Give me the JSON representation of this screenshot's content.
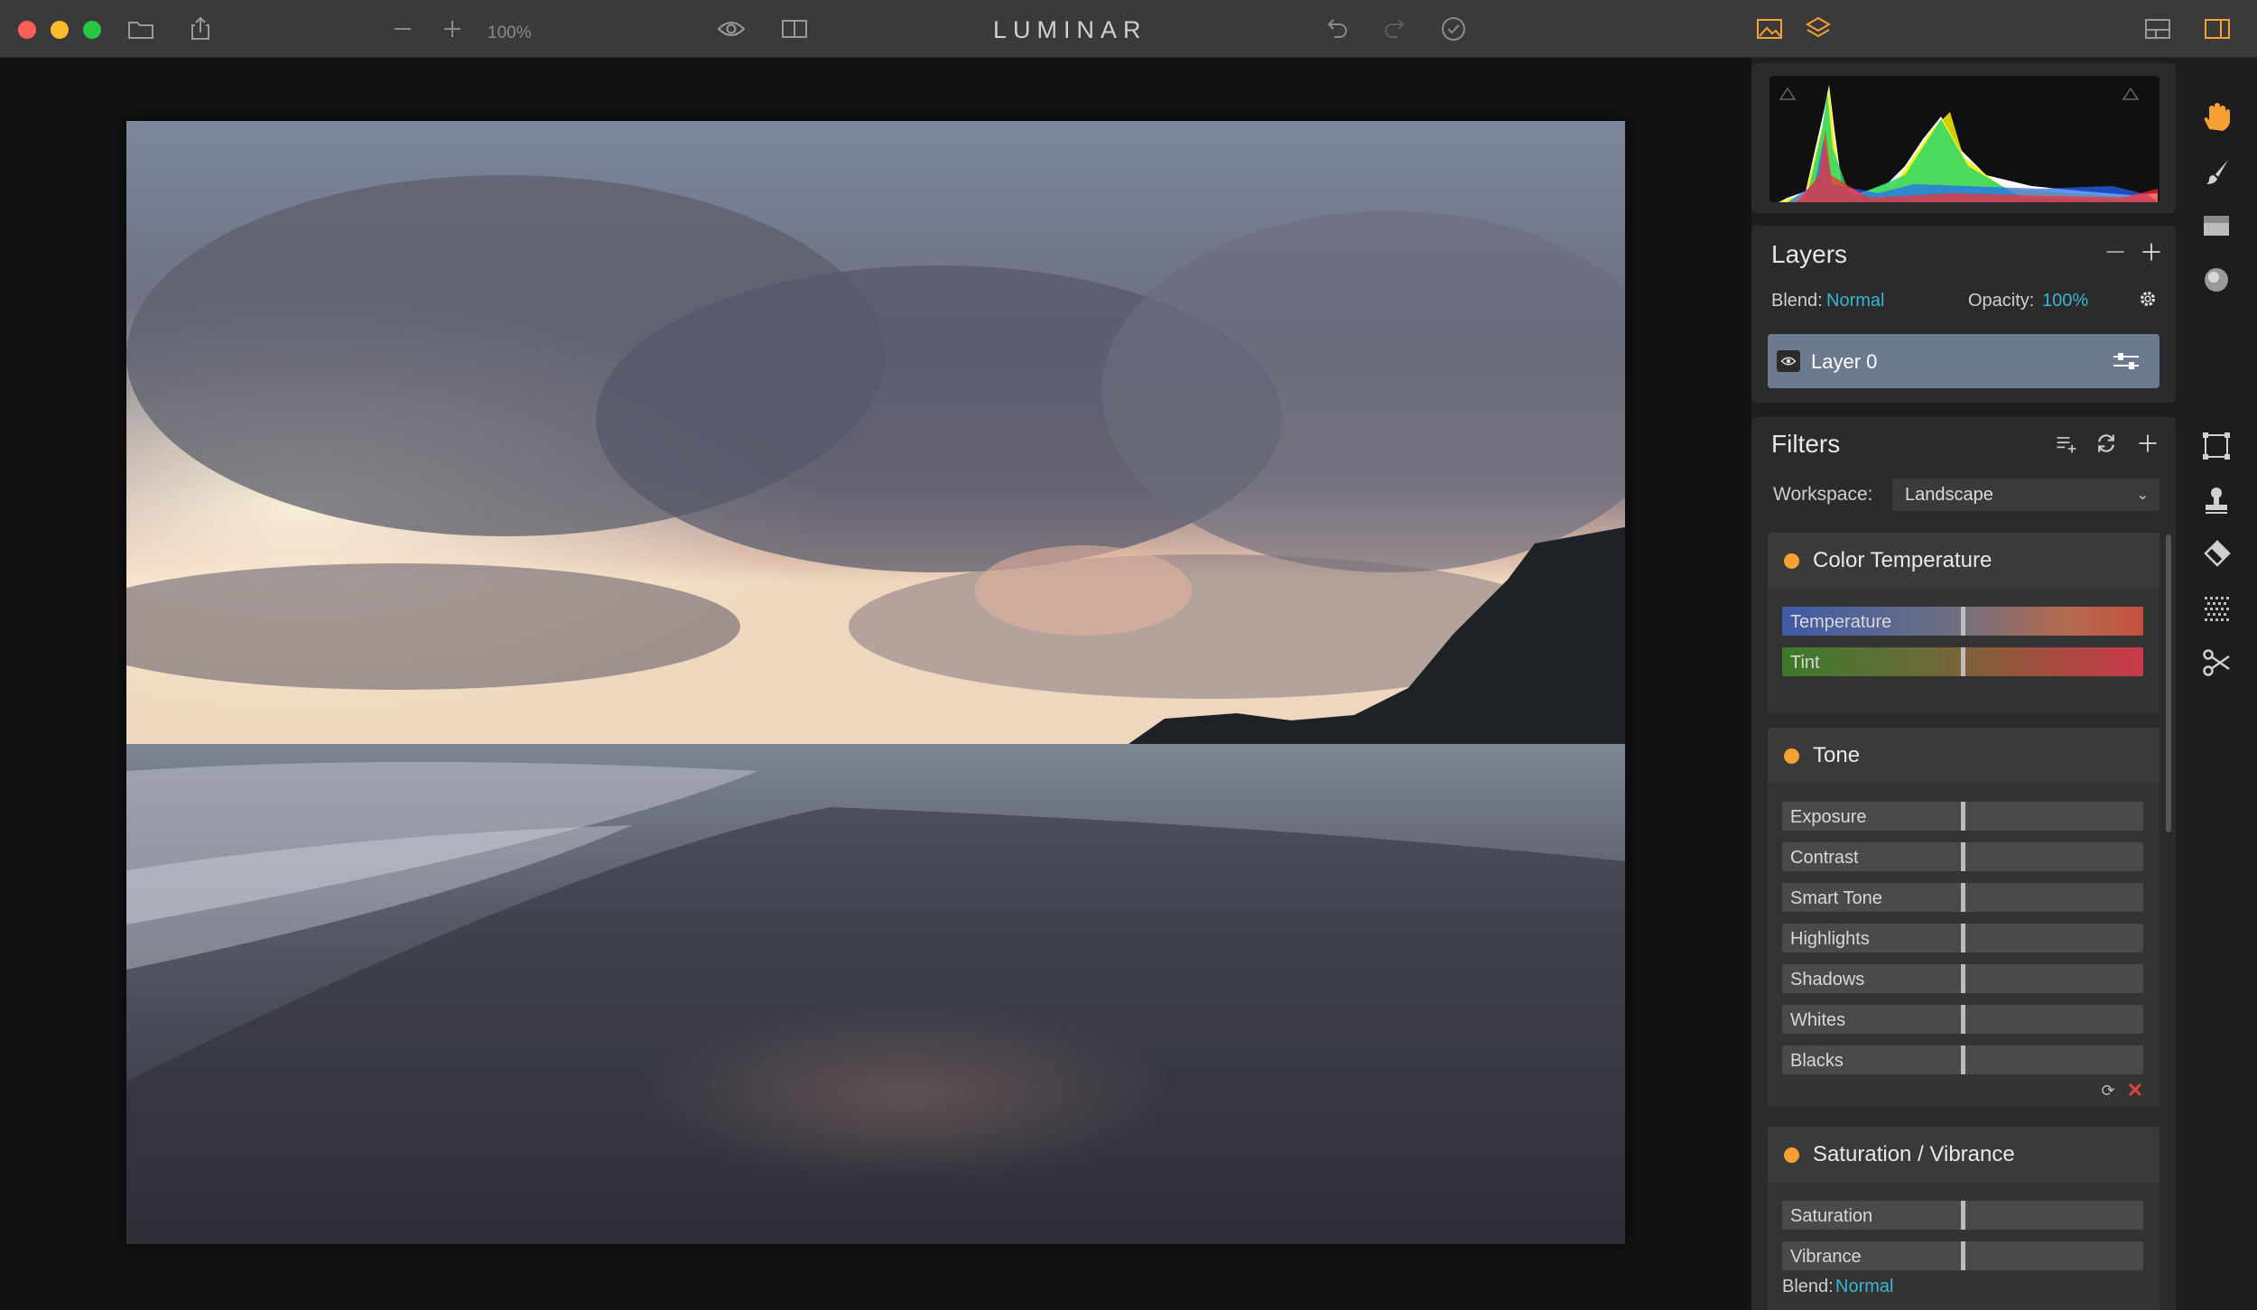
{
  "window": {
    "app_title": "LUMINAR",
    "zoom_level": "100%"
  },
  "icons": {
    "folder": "folder-icon",
    "share": "share-icon",
    "zoom_out": "minus-icon",
    "zoom_in": "plus-icon",
    "preview": "eye-icon",
    "compare": "split-view-icon",
    "undo": "undo-icon",
    "redo": "redo-icon",
    "history": "check-circle-icon",
    "image": "image-icon",
    "layers": "layers-icon",
    "layout": "layout-icon",
    "sidebar": "sidebar-icon"
  },
  "layers": {
    "title": "Layers",
    "blend_label": "Blend:",
    "blend_value": "Normal",
    "opacity_label": "Opacity:",
    "opacity_value": "100%",
    "items": [
      {
        "name": "Layer 0"
      }
    ]
  },
  "filters": {
    "title": "Filters",
    "workspace_label": "Workspace:",
    "workspace_value": "Landscape",
    "groups": [
      {
        "title": "Color Temperature",
        "sliders": [
          {
            "label": "Temperature",
            "value": 0.5
          },
          {
            "label": "Tint",
            "value": 0.5
          }
        ]
      },
      {
        "title": "Tone",
        "sliders": [
          {
            "label": "Exposure",
            "value": 0.5
          },
          {
            "label": "Contrast",
            "value": 0.5
          },
          {
            "label": "Smart Tone",
            "value": 0.5
          },
          {
            "label": "Highlights",
            "value": 0.5
          },
          {
            "label": "Shadows",
            "value": 0.5
          },
          {
            "label": "Whites",
            "value": 0.5
          },
          {
            "label": "Blacks",
            "value": 0.5
          }
        ]
      },
      {
        "title": "Saturation / Vibrance",
        "sliders": [
          {
            "label": "Saturation",
            "value": 0.5
          },
          {
            "label": "Vibrance",
            "value": 0.5
          }
        ],
        "blend_label": "Blend:",
        "blend_value": "Normal"
      }
    ]
  },
  "colors": {
    "accent": "#37b6d6",
    "filter_dot": "#f7a034",
    "layer_selected": "#6b7a8e",
    "tool_active": "#f7a034"
  },
  "tools": [
    "hand-icon",
    "brush-icon",
    "gradient-mask-icon",
    "radial-mask-icon",
    "transform-icon",
    "clone-stamp-icon",
    "eraser-icon",
    "noise-icon",
    "crop-icon"
  ]
}
